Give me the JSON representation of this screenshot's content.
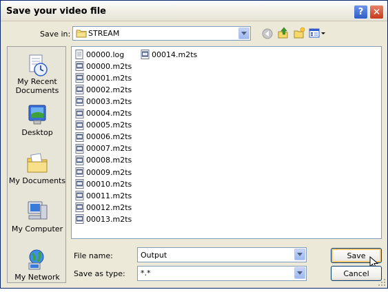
{
  "window": {
    "title": "Save your video file"
  },
  "save_in": {
    "label": "Save in:",
    "value": "STREAM"
  },
  "places": [
    {
      "label": "My Recent Documents",
      "icon": "recent-documents-icon"
    },
    {
      "label": "Desktop",
      "icon": "desktop-icon"
    },
    {
      "label": "My Documents",
      "icon": "my-documents-icon"
    },
    {
      "label": "My Computer",
      "icon": "my-computer-icon"
    },
    {
      "label": "My Network",
      "icon": "my-network-icon"
    }
  ],
  "files": [
    "00000.log",
    "00000.m2ts",
    "00001.m2ts",
    "00002.m2ts",
    "00003.m2ts",
    "00004.m2ts",
    "00005.m2ts",
    "00006.m2ts",
    "00007.m2ts",
    "00008.m2ts",
    "00009.m2ts",
    "00010.m2ts",
    "00011.m2ts",
    "00012.m2ts",
    "00013.m2ts",
    "00014.m2ts"
  ],
  "file_name": {
    "label": "File name:",
    "value": "Output"
  },
  "save_as_type": {
    "label": "Save as type:",
    "value": "*.*"
  },
  "buttons": {
    "save": "Save",
    "cancel": "Cancel"
  },
  "colors": {
    "title_gradient_top": "#ffffff",
    "dialog_bg": "#ece9d8",
    "border_blue": "#7f9db9"
  }
}
